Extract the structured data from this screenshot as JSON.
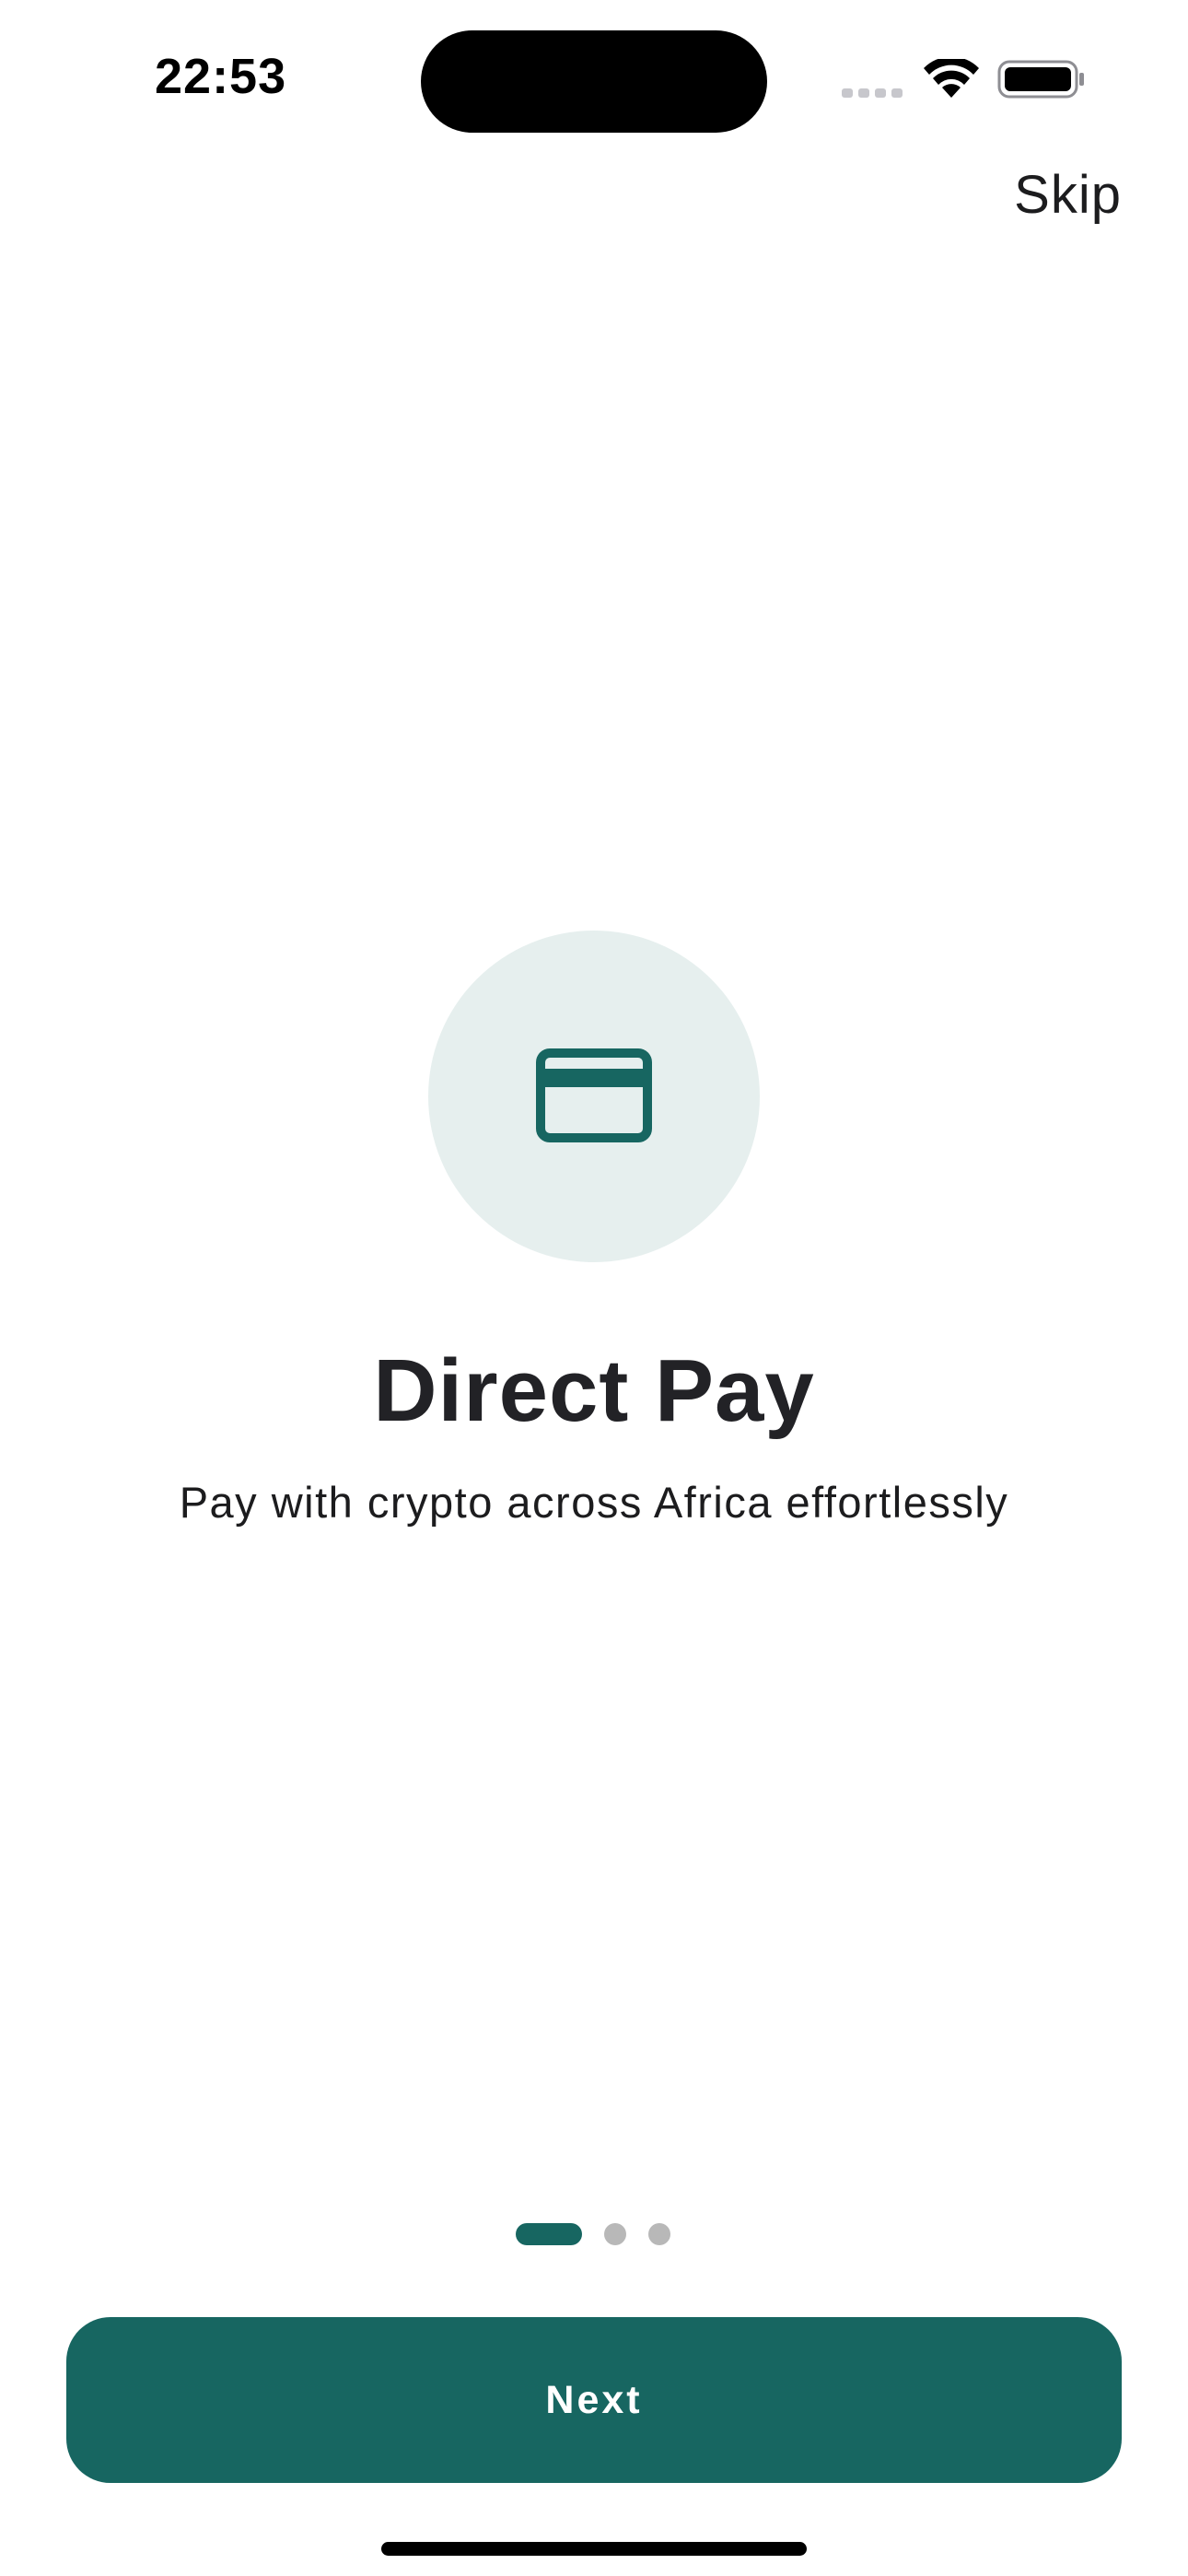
{
  "status_bar": {
    "time": "22:53",
    "signal_icon": "cellular-signal-icon",
    "wifi_icon": "wifi-icon",
    "battery_icon": "battery-icon"
  },
  "header": {
    "skip_label": "Skip"
  },
  "onboarding": {
    "icon": "credit-card-icon",
    "title": "Direct Pay",
    "subtitle": "Pay with crypto across Africa effortlessly",
    "current_page": 1,
    "total_pages": 3
  },
  "footer": {
    "next_label": "Next"
  },
  "colors": {
    "accent": "#176661",
    "icon_circle_bg": "#e6efee",
    "inactive_dot": "#b8b8b8",
    "text": "#1c1c1e"
  }
}
